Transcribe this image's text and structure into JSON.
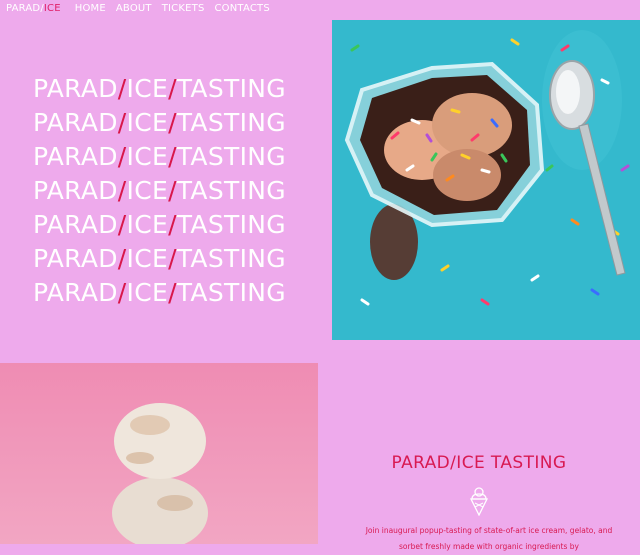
{
  "nav": {
    "logo_main": "PARAD/",
    "logo_accent": "ICE",
    "items": [
      "HOME",
      "ABOUT",
      "TICKETS",
      "CONTACTS"
    ]
  },
  "hero": {
    "lines": [
      {
        "a": "PARAD",
        "s1": "/",
        "b": "ICE",
        "s2": "/",
        "c": "TASTING"
      },
      {
        "a": "PARAD",
        "s1": "/",
        "b": "ICE",
        "s2": "/",
        "c": "TASTING"
      },
      {
        "a": "PARAD",
        "s1": "/",
        "b": "ICE",
        "s2": "/",
        "c": "TASTING"
      },
      {
        "a": "PARAD",
        "s1": "/",
        "b": "ICE",
        "s2": "/",
        "c": "TASTING"
      },
      {
        "a": "PARAD",
        "s1": "/",
        "b": "ICE",
        "s2": "/",
        "c": "TASTING"
      },
      {
        "a": "PARAD",
        "s1": "/",
        "b": "ICE",
        "s2": "/",
        "c": "TASTING"
      },
      {
        "a": "PARAD",
        "s1": "/",
        "b": "ICE",
        "s2": "/",
        "c": "TASTING"
      }
    ]
  },
  "info": {
    "title": "PARAD/ICE TASTING",
    "icon": "ice-cream-cone-icon",
    "text": "Join inaugural popup-tasting of state-of-art ice cream, gelato, and sorbet freshly made with organic ingredients by"
  },
  "colors": {
    "background": "#eeaaec",
    "accent": "#d81a52",
    "photo_top_bg": "#2fb8cc",
    "photo_bottom_bg": "#ef86ad"
  }
}
